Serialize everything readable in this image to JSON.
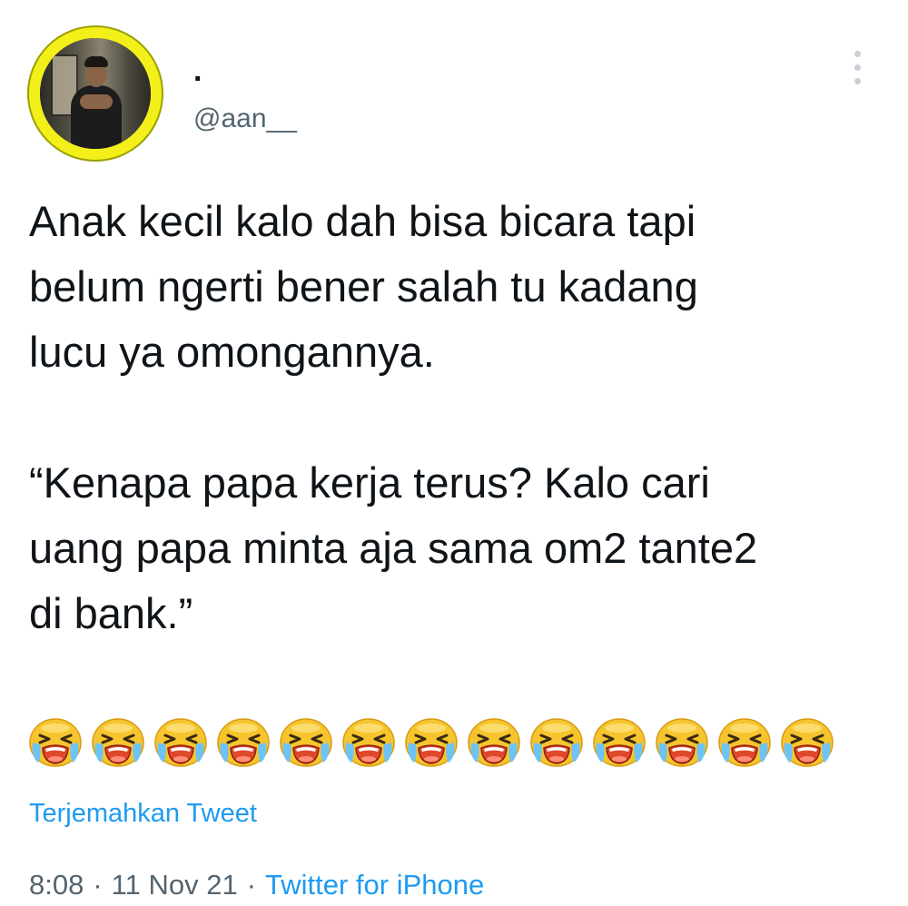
{
  "author": {
    "display_name": ".",
    "handle": "@aan__",
    "avatar_ring_color": "#f2ef1a"
  },
  "more_menu_icon": "vertical-ellipsis-icon",
  "tweet": {
    "paragraph_1": "Anak kecil kalo dah bisa bicara tapi\nbelum ngerti bener salah tu kadang\nlucu ya omongannya.",
    "paragraph_2": "“Kenapa papa kerja terus? Kalo cari\nuang papa minta aja sama om2 tante2\ndi bank.”",
    "emoji": "loudly-crying-face",
    "emoji_count": 13
  },
  "translate_label": "Terjemahkan Tweet",
  "meta": {
    "time": "8:08",
    "date": "11 Nov 21",
    "separator": "·",
    "source": "Twitter for iPhone"
  },
  "colors": {
    "text_primary": "#0f1419",
    "text_secondary": "#536471",
    "link_blue": "#1d9bf0",
    "emoji_yellow": "#f6c52e",
    "emoji_mouth": "#e0482a"
  }
}
